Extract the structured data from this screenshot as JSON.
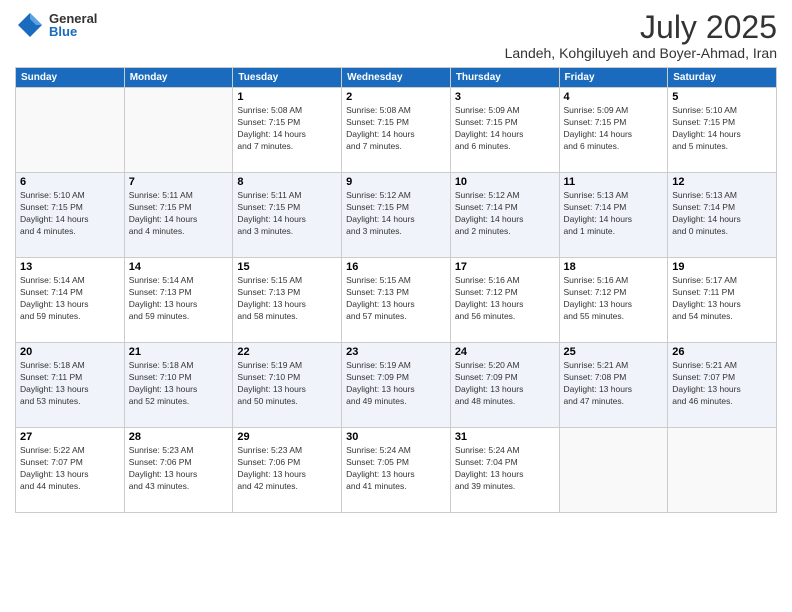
{
  "logo": {
    "general": "General",
    "blue": "Blue"
  },
  "title": "July 2025",
  "subtitle": "Landeh, Kohgiluyeh and Boyer-Ahmad, Iran",
  "days_header": [
    "Sunday",
    "Monday",
    "Tuesday",
    "Wednesday",
    "Thursday",
    "Friday",
    "Saturday"
  ],
  "weeks": [
    [
      {
        "day": "",
        "info": ""
      },
      {
        "day": "",
        "info": ""
      },
      {
        "day": "1",
        "info": "Sunrise: 5:08 AM\nSunset: 7:15 PM\nDaylight: 14 hours\nand 7 minutes."
      },
      {
        "day": "2",
        "info": "Sunrise: 5:08 AM\nSunset: 7:15 PM\nDaylight: 14 hours\nand 7 minutes."
      },
      {
        "day": "3",
        "info": "Sunrise: 5:09 AM\nSunset: 7:15 PM\nDaylight: 14 hours\nand 6 minutes."
      },
      {
        "day": "4",
        "info": "Sunrise: 5:09 AM\nSunset: 7:15 PM\nDaylight: 14 hours\nand 6 minutes."
      },
      {
        "day": "5",
        "info": "Sunrise: 5:10 AM\nSunset: 7:15 PM\nDaylight: 14 hours\nand 5 minutes."
      }
    ],
    [
      {
        "day": "6",
        "info": "Sunrise: 5:10 AM\nSunset: 7:15 PM\nDaylight: 14 hours\nand 4 minutes."
      },
      {
        "day": "7",
        "info": "Sunrise: 5:11 AM\nSunset: 7:15 PM\nDaylight: 14 hours\nand 4 minutes."
      },
      {
        "day": "8",
        "info": "Sunrise: 5:11 AM\nSunset: 7:15 PM\nDaylight: 14 hours\nand 3 minutes."
      },
      {
        "day": "9",
        "info": "Sunrise: 5:12 AM\nSunset: 7:15 PM\nDaylight: 14 hours\nand 3 minutes."
      },
      {
        "day": "10",
        "info": "Sunrise: 5:12 AM\nSunset: 7:14 PM\nDaylight: 14 hours\nand 2 minutes."
      },
      {
        "day": "11",
        "info": "Sunrise: 5:13 AM\nSunset: 7:14 PM\nDaylight: 14 hours\nand 1 minute."
      },
      {
        "day": "12",
        "info": "Sunrise: 5:13 AM\nSunset: 7:14 PM\nDaylight: 14 hours\nand 0 minutes."
      }
    ],
    [
      {
        "day": "13",
        "info": "Sunrise: 5:14 AM\nSunset: 7:14 PM\nDaylight: 13 hours\nand 59 minutes."
      },
      {
        "day": "14",
        "info": "Sunrise: 5:14 AM\nSunset: 7:13 PM\nDaylight: 13 hours\nand 59 minutes."
      },
      {
        "day": "15",
        "info": "Sunrise: 5:15 AM\nSunset: 7:13 PM\nDaylight: 13 hours\nand 58 minutes."
      },
      {
        "day": "16",
        "info": "Sunrise: 5:15 AM\nSunset: 7:13 PM\nDaylight: 13 hours\nand 57 minutes."
      },
      {
        "day": "17",
        "info": "Sunrise: 5:16 AM\nSunset: 7:12 PM\nDaylight: 13 hours\nand 56 minutes."
      },
      {
        "day": "18",
        "info": "Sunrise: 5:16 AM\nSunset: 7:12 PM\nDaylight: 13 hours\nand 55 minutes."
      },
      {
        "day": "19",
        "info": "Sunrise: 5:17 AM\nSunset: 7:11 PM\nDaylight: 13 hours\nand 54 minutes."
      }
    ],
    [
      {
        "day": "20",
        "info": "Sunrise: 5:18 AM\nSunset: 7:11 PM\nDaylight: 13 hours\nand 53 minutes."
      },
      {
        "day": "21",
        "info": "Sunrise: 5:18 AM\nSunset: 7:10 PM\nDaylight: 13 hours\nand 52 minutes."
      },
      {
        "day": "22",
        "info": "Sunrise: 5:19 AM\nSunset: 7:10 PM\nDaylight: 13 hours\nand 50 minutes."
      },
      {
        "day": "23",
        "info": "Sunrise: 5:19 AM\nSunset: 7:09 PM\nDaylight: 13 hours\nand 49 minutes."
      },
      {
        "day": "24",
        "info": "Sunrise: 5:20 AM\nSunset: 7:09 PM\nDaylight: 13 hours\nand 48 minutes."
      },
      {
        "day": "25",
        "info": "Sunrise: 5:21 AM\nSunset: 7:08 PM\nDaylight: 13 hours\nand 47 minutes."
      },
      {
        "day": "26",
        "info": "Sunrise: 5:21 AM\nSunset: 7:07 PM\nDaylight: 13 hours\nand 46 minutes."
      }
    ],
    [
      {
        "day": "27",
        "info": "Sunrise: 5:22 AM\nSunset: 7:07 PM\nDaylight: 13 hours\nand 44 minutes."
      },
      {
        "day": "28",
        "info": "Sunrise: 5:23 AM\nSunset: 7:06 PM\nDaylight: 13 hours\nand 43 minutes."
      },
      {
        "day": "29",
        "info": "Sunrise: 5:23 AM\nSunset: 7:06 PM\nDaylight: 13 hours\nand 42 minutes."
      },
      {
        "day": "30",
        "info": "Sunrise: 5:24 AM\nSunset: 7:05 PM\nDaylight: 13 hours\nand 41 minutes."
      },
      {
        "day": "31",
        "info": "Sunrise: 5:24 AM\nSunset: 7:04 PM\nDaylight: 13 hours\nand 39 minutes."
      },
      {
        "day": "",
        "info": ""
      },
      {
        "day": "",
        "info": ""
      }
    ]
  ]
}
